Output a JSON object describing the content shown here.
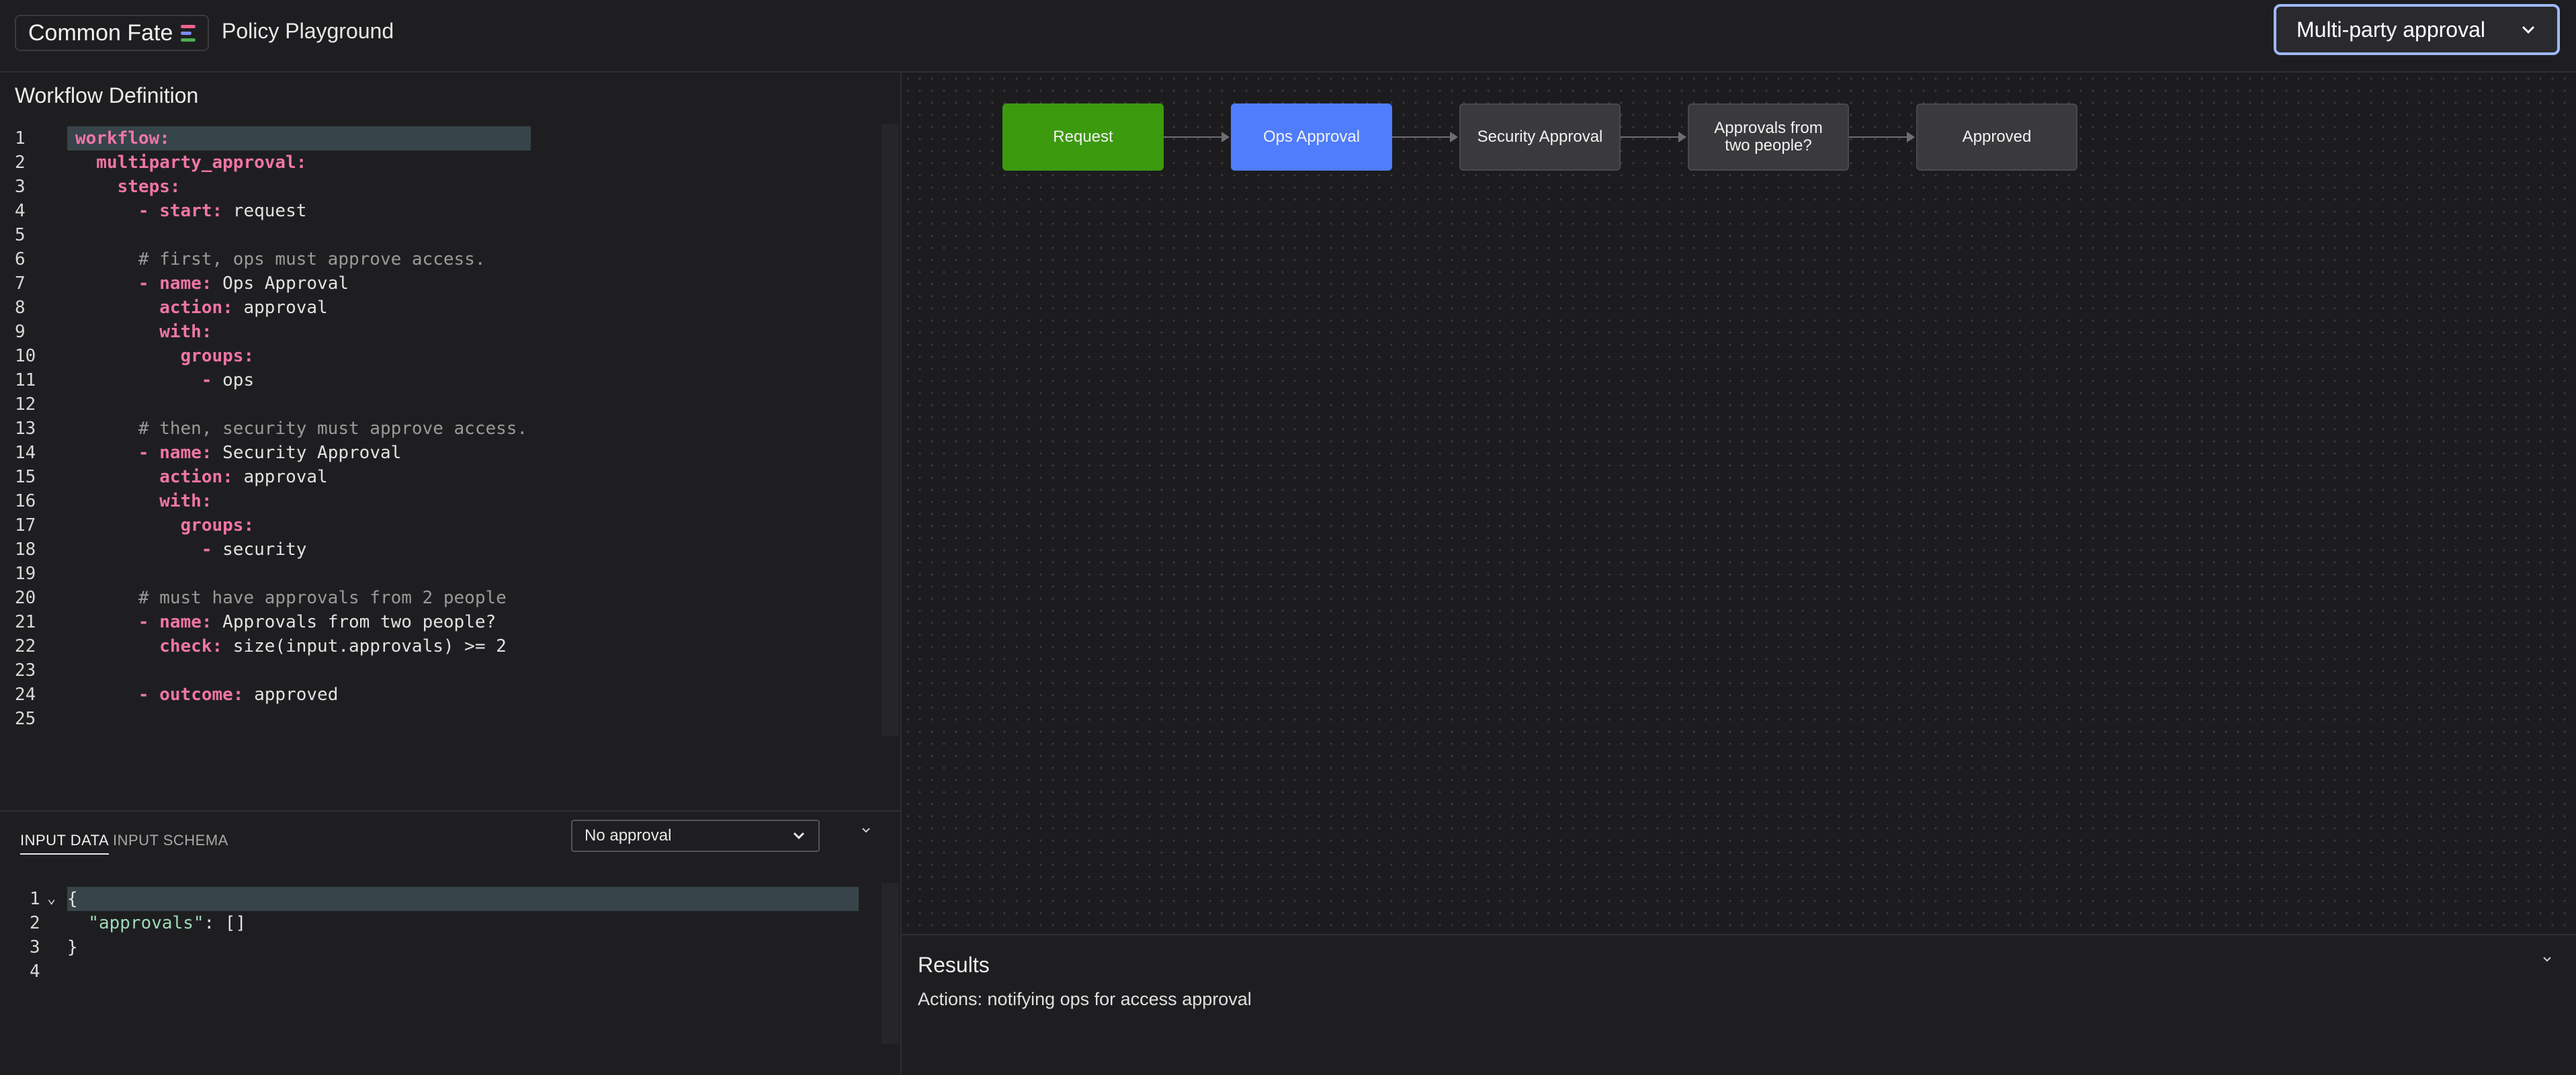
{
  "header": {
    "brand": "Common Fate",
    "brand_colors": [
      "#f06292",
      "#7c8cf8",
      "#4caf50"
    ],
    "title": "Policy Playground",
    "policy_select": {
      "value": "Multi-party approval"
    }
  },
  "workflow": {
    "title": "Workflow Definition",
    "lines": [
      {
        "n": "1",
        "segs": [
          {
            "t": "workflow:",
            "c": "k"
          }
        ]
      },
      {
        "n": "2",
        "segs": [
          {
            "t": "  multiparty_approval:",
            "c": "k"
          }
        ]
      },
      {
        "n": "3",
        "segs": [
          {
            "t": "    steps:",
            "c": "k"
          }
        ]
      },
      {
        "n": "4",
        "segs": [
          {
            "t": "      - ",
            "c": "k"
          },
          {
            "t": "start:",
            "c": "k"
          },
          {
            "t": " request",
            "c": "v"
          }
        ]
      },
      {
        "n": "5",
        "segs": []
      },
      {
        "n": "6",
        "segs": [
          {
            "t": "      # first, ops must approve access.",
            "c": "c"
          }
        ]
      },
      {
        "n": "7",
        "segs": [
          {
            "t": "      - ",
            "c": "k"
          },
          {
            "t": "name:",
            "c": "k"
          },
          {
            "t": " Ops Approval",
            "c": "v"
          }
        ]
      },
      {
        "n": "8",
        "segs": [
          {
            "t": "        action:",
            "c": "k"
          },
          {
            "t": " approval",
            "c": "v"
          }
        ]
      },
      {
        "n": "9",
        "segs": [
          {
            "t": "        with:",
            "c": "k"
          }
        ]
      },
      {
        "n": "10",
        "segs": [
          {
            "t": "          groups:",
            "c": "k"
          }
        ]
      },
      {
        "n": "11",
        "segs": [
          {
            "t": "            - ",
            "c": "k"
          },
          {
            "t": "ops",
            "c": "v"
          }
        ]
      },
      {
        "n": "12",
        "segs": []
      },
      {
        "n": "13",
        "segs": [
          {
            "t": "      # then, security must approve access.",
            "c": "c"
          }
        ]
      },
      {
        "n": "14",
        "segs": [
          {
            "t": "      - ",
            "c": "k"
          },
          {
            "t": "name:",
            "c": "k"
          },
          {
            "t": " Security Approval",
            "c": "v"
          }
        ]
      },
      {
        "n": "15",
        "segs": [
          {
            "t": "        action:",
            "c": "k"
          },
          {
            "t": " approval",
            "c": "v"
          }
        ]
      },
      {
        "n": "16",
        "segs": [
          {
            "t": "        with:",
            "c": "k"
          }
        ]
      },
      {
        "n": "17",
        "segs": [
          {
            "t": "          groups:",
            "c": "k"
          }
        ]
      },
      {
        "n": "18",
        "segs": [
          {
            "t": "            - ",
            "c": "k"
          },
          {
            "t": "security",
            "c": "v"
          }
        ]
      },
      {
        "n": "19",
        "segs": []
      },
      {
        "n": "20",
        "segs": [
          {
            "t": "      # must have approvals from 2 people",
            "c": "c"
          }
        ]
      },
      {
        "n": "21",
        "segs": [
          {
            "t": "      - ",
            "c": "k"
          },
          {
            "t": "name:",
            "c": "k"
          },
          {
            "t": " Approvals from two people?",
            "c": "v"
          }
        ]
      },
      {
        "n": "22",
        "segs": [
          {
            "t": "        check:",
            "c": "k"
          },
          {
            "t": " size(input.approvals) >= 2",
            "c": "v"
          }
        ]
      },
      {
        "n": "23",
        "segs": []
      },
      {
        "n": "24",
        "segs": [
          {
            "t": "      - ",
            "c": "k"
          },
          {
            "t": "outcome:",
            "c": "k"
          },
          {
            "t": " approved",
            "c": "v"
          }
        ]
      },
      {
        "n": "25",
        "segs": []
      }
    ]
  },
  "input": {
    "tabs": [
      "INPUT DATA",
      "INPUT SCHEMA"
    ],
    "approval_select": {
      "value": "No approval"
    },
    "json_lines": [
      {
        "n": "1",
        "fold": "⌄",
        "segs": [
          {
            "t": "{",
            "c": "v"
          }
        ]
      },
      {
        "n": "2",
        "fold": "",
        "segs": [
          {
            "t": "  ",
            "c": "v"
          },
          {
            "t": "\"approvals\"",
            "c": "jstr"
          },
          {
            "t": ": []",
            "c": "v"
          }
        ]
      },
      {
        "n": "3",
        "fold": "",
        "segs": [
          {
            "t": "}",
            "c": "v"
          }
        ]
      },
      {
        "n": "4",
        "fold": "",
        "segs": []
      }
    ]
  },
  "flow": {
    "nodes": [
      {
        "id": "request",
        "label": "Request",
        "state": "green"
      },
      {
        "id": "ops-approval",
        "label": "Ops Approval",
        "state": "blue"
      },
      {
        "id": "security-approval",
        "label": "Security Approval",
        "state": "gray"
      },
      {
        "id": "approvals-two-people",
        "label": "Approvals from two people?",
        "state": "gray"
      },
      {
        "id": "approved",
        "label": "Approved",
        "state": "gray"
      }
    ]
  },
  "results": {
    "title": "Results",
    "text": "Actions: notifying ops for access approval"
  }
}
